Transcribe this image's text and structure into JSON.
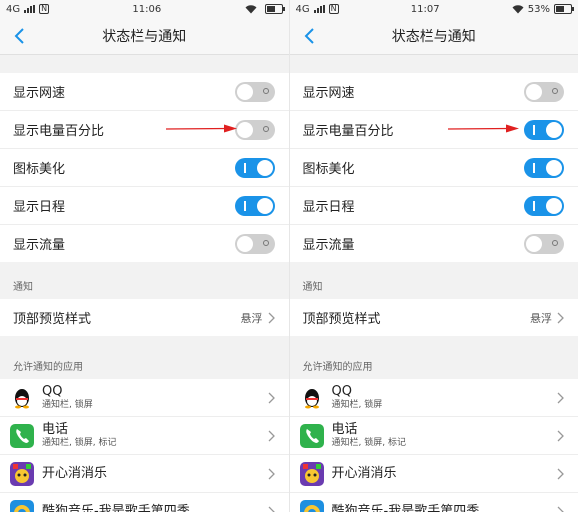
{
  "panels": [
    {
      "status": {
        "network": "4G",
        "time": "11:06",
        "battery": "",
        "battery_level": 0.55
      },
      "header": {
        "title": "状态栏与通知"
      },
      "toggles": [
        {
          "label": "显示网速",
          "on": false
        },
        {
          "label": "显示电量百分比",
          "on": false
        },
        {
          "label": "图标美化",
          "on": true
        },
        {
          "label": "显示日程",
          "on": true
        },
        {
          "label": "显示流量",
          "on": false
        }
      ],
      "notify_header": "通知",
      "preview": {
        "label": "顶部预览样式",
        "value": "悬浮"
      },
      "apps_header": "允许通知的应用",
      "apps": [
        {
          "name": "QQ",
          "sub": "通知栏, 锁屏",
          "icon": "qq-icon"
        },
        {
          "name": "电话",
          "sub": "通知栏, 锁屏, 标记",
          "icon": "phone-icon"
        },
        {
          "name": "开心消消乐",
          "sub": "",
          "icon": "game-icon"
        },
        {
          "name": "酷狗音乐-我是歌手第四季",
          "sub": "",
          "icon": "kugou-icon"
        }
      ]
    },
    {
      "status": {
        "network": "4G",
        "time": "11:07",
        "battery": "53%",
        "battery_level": 0.53
      },
      "header": {
        "title": "状态栏与通知"
      },
      "toggles": [
        {
          "label": "显示网速",
          "on": false
        },
        {
          "label": "显示电量百分比",
          "on": true
        },
        {
          "label": "图标美化",
          "on": true
        },
        {
          "label": "显示日程",
          "on": true
        },
        {
          "label": "显示流量",
          "on": false
        }
      ],
      "notify_header": "通知",
      "preview": {
        "label": "顶部预览样式",
        "value": "悬浮"
      },
      "apps_header": "允许通知的应用",
      "apps": [
        {
          "name": "QQ",
          "sub": "通知栏, 锁屏",
          "icon": "qq-icon"
        },
        {
          "name": "电话",
          "sub": "通知栏, 锁屏, 标记",
          "icon": "phone-icon"
        },
        {
          "name": "开心消消乐",
          "sub": "",
          "icon": "game-icon"
        },
        {
          "name": "酷狗音乐-我是歌手第四季",
          "sub": "",
          "icon": "kugou-icon"
        }
      ]
    }
  ],
  "colors": {
    "toggle_on": "#1a93e8",
    "toggle_off": "#cfcfcf",
    "arrow": "#e02020"
  }
}
